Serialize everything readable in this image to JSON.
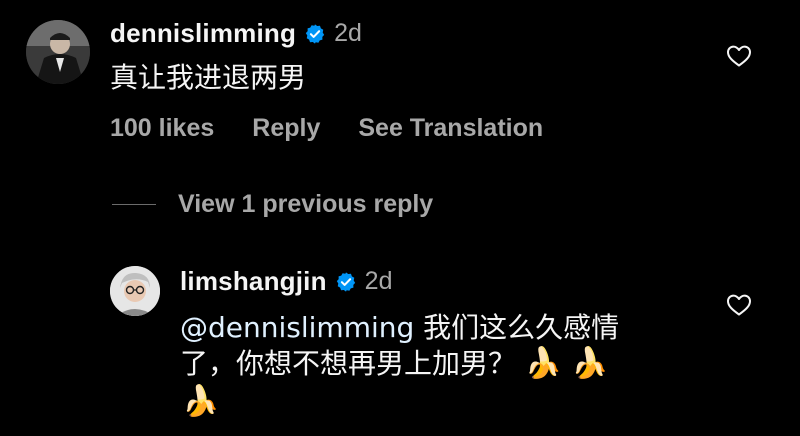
{
  "comment": {
    "username": "dennislimming",
    "verified": true,
    "time": "2d",
    "text": "真让我进退两男",
    "likes": "100 likes",
    "reply_label": "Reply",
    "translate_label": "See Translation",
    "heart_icon": "heart-outline-icon"
  },
  "view_replies": {
    "label": "View 1 previous reply"
  },
  "reply": {
    "username": "limshangjin",
    "verified": true,
    "time": "2d",
    "mention": "@dennislimming",
    "text_line1": " 我们这么久感情",
    "text_line2": "了，你想不想再男上加男？",
    "emoji": "🍌",
    "heart_icon": "heart-outline-icon"
  },
  "colors": {
    "background": "#000000",
    "primary_text": "#f5f5f5",
    "secondary_text": "#a8a8a8",
    "verified_badge": "#0095f6"
  }
}
